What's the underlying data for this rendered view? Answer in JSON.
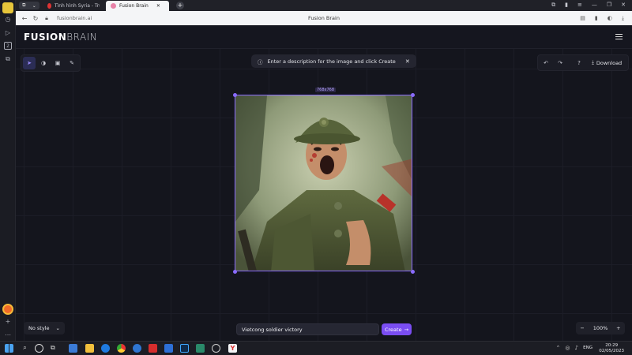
{
  "browser": {
    "tabs": [
      {
        "label": "Tình hình Syria - Trung Đôn"
      },
      {
        "label": "Fusion Brain"
      }
    ],
    "url": "fusionbrain.ai",
    "page_title": "Fusion Brain",
    "side_badge": "2"
  },
  "app": {
    "logo_bold": "FUSION",
    "logo_light": "BRAIN",
    "hint": "Enter a description for the image and click Create",
    "download_label": "Download",
    "size_label": "768x768",
    "style_select": "No style",
    "prompt_value": "Vietcong soldier victory",
    "create_label": "Create",
    "zoom_level": "100%"
  },
  "taskbar": {
    "lang": "ENG",
    "time": "20:29",
    "date": "02/05/2023"
  },
  "colors": {
    "accent": "#7a4df2",
    "selection": "#8a6bff",
    "canvas_bg": "#14151d"
  }
}
